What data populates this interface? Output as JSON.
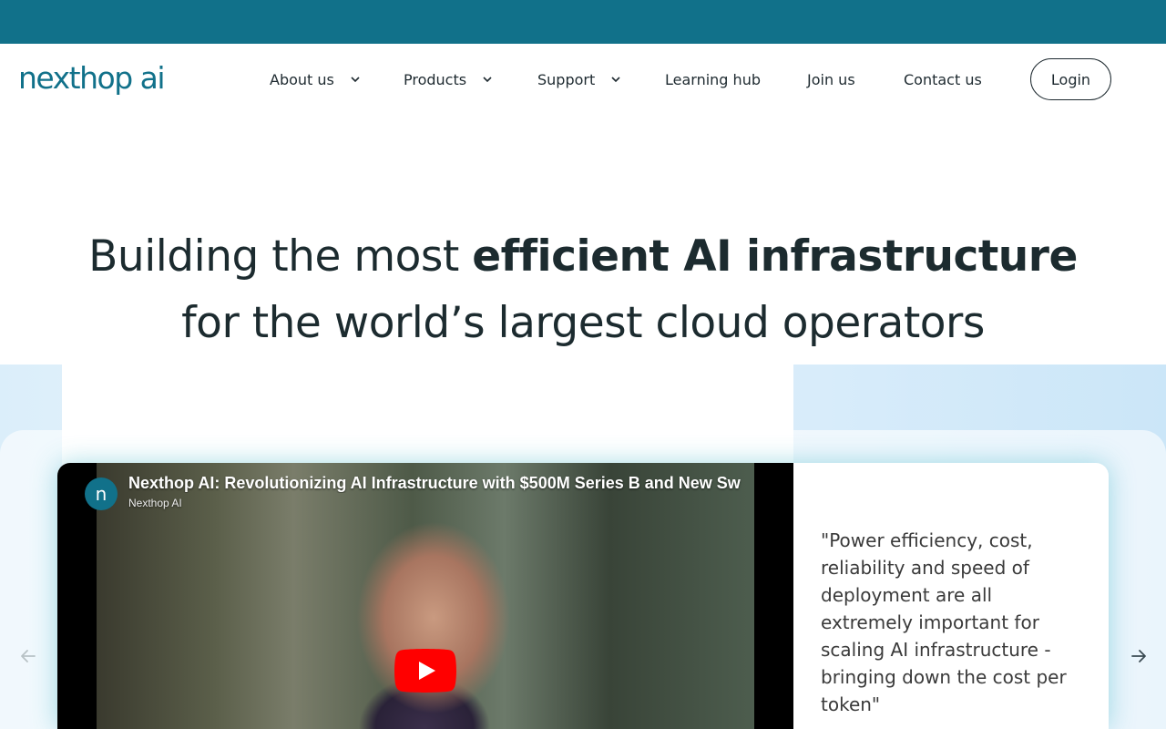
{
  "brand": {
    "logo_text": "nexthop ai"
  },
  "nav": {
    "items": [
      {
        "label": "About us",
        "has_dropdown": true
      },
      {
        "label": "Products",
        "has_dropdown": true
      },
      {
        "label": "Support",
        "has_dropdown": true
      },
      {
        "label": "Learning hub",
        "has_dropdown": false
      },
      {
        "label": "Join us",
        "has_dropdown": false
      },
      {
        "label": "Contact us",
        "has_dropdown": false
      }
    ],
    "login_label": "Login"
  },
  "hero": {
    "line1_regular": "Building the most ",
    "line1_bold": "efficient AI infrastructure",
    "line2": "for the world’s largest cloud operators"
  },
  "video": {
    "title": "Nexthop AI: Revolutionizing AI Infrastructure with $500M Series B and New Sw",
    "channel": "Nexthop AI",
    "avatar_text": "n"
  },
  "testimonial": {
    "quote": "\"Power efficiency, cost, reliability and speed of deployment are all extremely important for scaling AI infrastructure - bringing down the cost per token\""
  },
  "colors": {
    "brand_teal": "#11718a",
    "text_dark": "#1c2b2f",
    "youtube_red": "#ff0000"
  },
  "icons": {
    "dropdown": "chevron-down-icon",
    "prev": "arrow-left-icon",
    "next": "arrow-right-icon",
    "play": "play-icon"
  }
}
